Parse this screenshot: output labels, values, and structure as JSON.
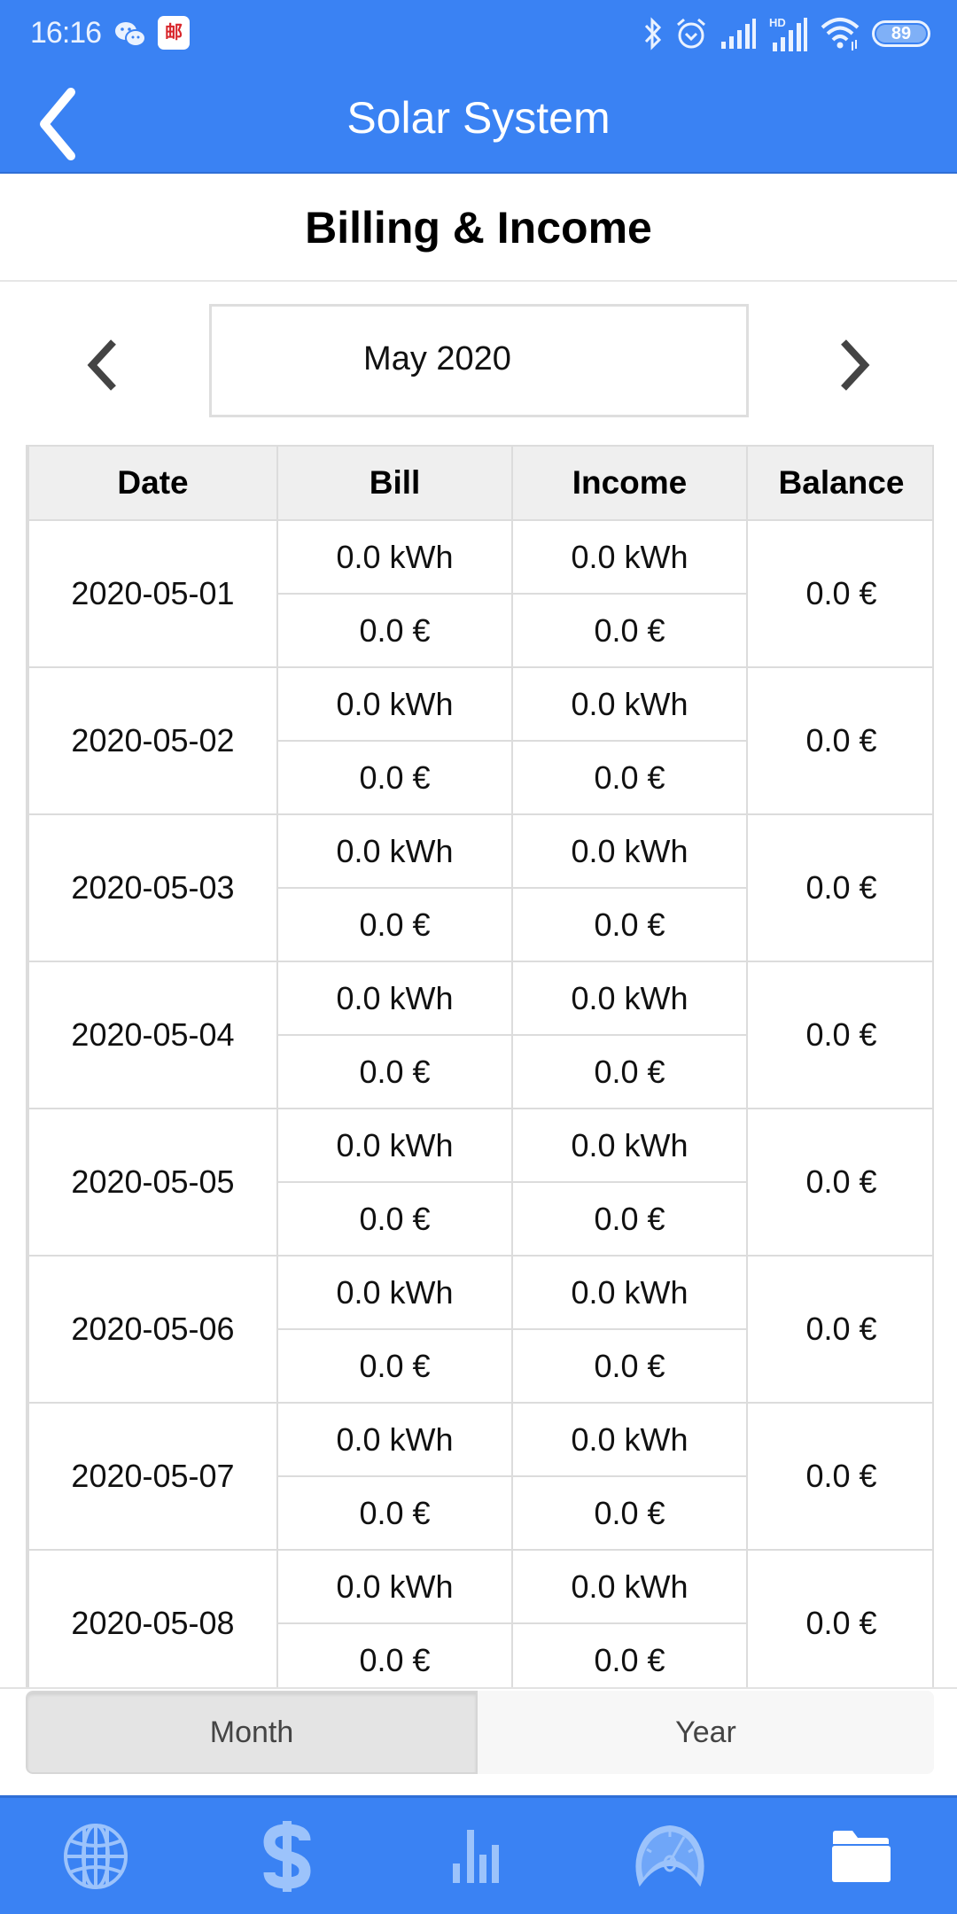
{
  "status_bar": {
    "time": "16:16",
    "app_badge": "邮",
    "battery": "89",
    "hd_label": "HD"
  },
  "header": {
    "title": "Solar System"
  },
  "page": {
    "title": "Billing & Income"
  },
  "period": {
    "label": "May 2020"
  },
  "table": {
    "columns": [
      "Date",
      "Bill",
      "Income",
      "Balance"
    ],
    "rows": [
      {
        "date": "2020-05-01",
        "bill_kwh": "0.0 kWh",
        "bill_eur": "0.0 €",
        "income_kwh": "0.0 kWh",
        "income_eur": "0.0 €",
        "balance": "0.0 €"
      },
      {
        "date": "2020-05-02",
        "bill_kwh": "0.0 kWh",
        "bill_eur": "0.0 €",
        "income_kwh": "0.0 kWh",
        "income_eur": "0.0 €",
        "balance": "0.0 €"
      },
      {
        "date": "2020-05-03",
        "bill_kwh": "0.0 kWh",
        "bill_eur": "0.0 €",
        "income_kwh": "0.0 kWh",
        "income_eur": "0.0 €",
        "balance": "0.0 €"
      },
      {
        "date": "2020-05-04",
        "bill_kwh": "0.0 kWh",
        "bill_eur": "0.0 €",
        "income_kwh": "0.0 kWh",
        "income_eur": "0.0 €",
        "balance": "0.0 €"
      },
      {
        "date": "2020-05-05",
        "bill_kwh": "0.0 kWh",
        "bill_eur": "0.0 €",
        "income_kwh": "0.0 kWh",
        "income_eur": "0.0 €",
        "balance": "0.0 €"
      },
      {
        "date": "2020-05-06",
        "bill_kwh": "0.0 kWh",
        "bill_eur": "0.0 €",
        "income_kwh": "0.0 kWh",
        "income_eur": "0.0 €",
        "balance": "0.0 €"
      },
      {
        "date": "2020-05-07",
        "bill_kwh": "0.0 kWh",
        "bill_eur": "0.0 €",
        "income_kwh": "0.0 kWh",
        "income_eur": "0.0 €",
        "balance": "0.0 €"
      },
      {
        "date": "2020-05-08",
        "bill_kwh": "0.0 kWh",
        "bill_eur": "0.0 €",
        "income_kwh": "0.0 kWh",
        "income_eur": "0.0 €",
        "balance": "0.0 €"
      }
    ]
  },
  "segment": {
    "options": [
      "Month",
      "Year"
    ],
    "selected": "Month"
  },
  "bottom_nav": {
    "items": [
      {
        "icon": "globe-icon",
        "active": false
      },
      {
        "icon": "dollar-icon",
        "active": false
      },
      {
        "icon": "bar-chart-icon",
        "active": false
      },
      {
        "icon": "gauge-icon",
        "active": false
      },
      {
        "icon": "folder-icon",
        "active": true
      }
    ]
  },
  "colors": {
    "primary": "#3a82f3",
    "nav_inactive": "#9cc3fb",
    "nav_active": "#ffffff",
    "header_cell_bg": "#efefef",
    "border": "#dcdcdc"
  }
}
